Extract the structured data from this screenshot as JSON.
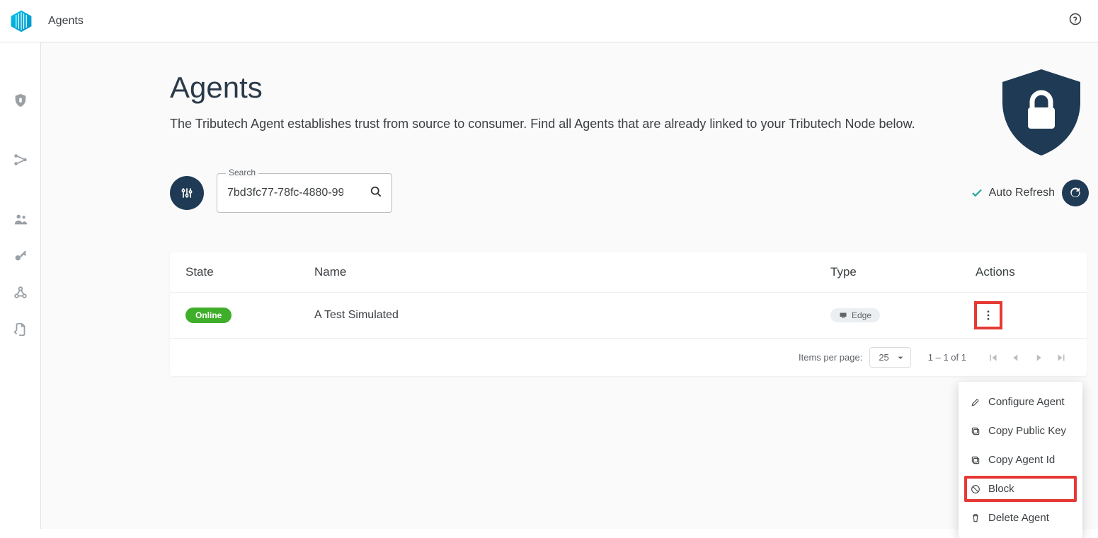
{
  "breadcrumb": "Agents",
  "page": {
    "title": "Agents",
    "subtitle": "The Tributech Agent establishes trust from source to consumer. Find all Agents that are already linked to your Tributech Node below."
  },
  "search": {
    "label": "Search",
    "value": "7bd3fc77-78fc-4880-99"
  },
  "autoRefresh": {
    "label": "Auto Refresh"
  },
  "table": {
    "headers": {
      "state": "State",
      "name": "Name",
      "type": "Type",
      "actions": "Actions"
    },
    "rows": [
      {
        "state": "Online",
        "name": "A Test Simulated",
        "type": "Edge"
      }
    ]
  },
  "pagination": {
    "ipp_label": "Items per page:",
    "ipp_value": "25",
    "range": "1 – 1 of 1"
  },
  "menu": {
    "configure": "Configure Agent",
    "copy_key": "Copy Public Key",
    "copy_id": "Copy Agent Id",
    "block": "Block",
    "delete": "Delete Agent"
  }
}
